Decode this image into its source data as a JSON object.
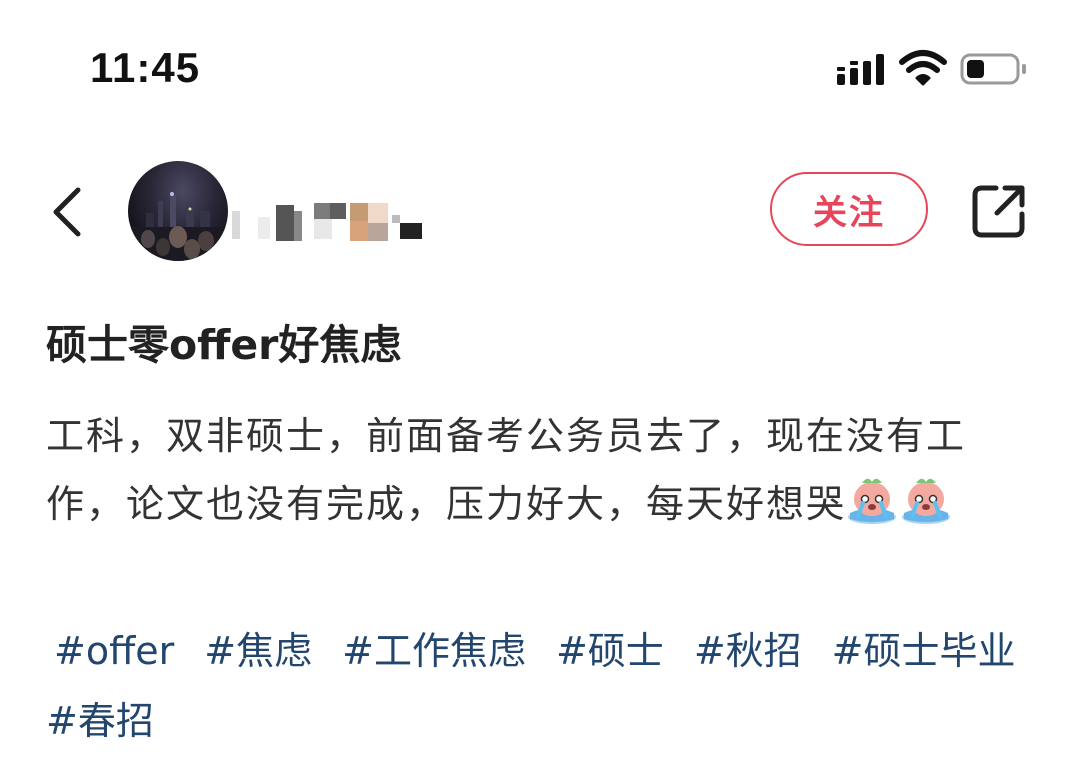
{
  "status_bar": {
    "time": "11:45",
    "signal_icon": "cellular-signal-icon",
    "wifi_icon": "wifi-icon",
    "battery_icon": "battery-icon",
    "battery_level": 0.3
  },
  "header": {
    "back_icon": "chevron-left-icon",
    "avatar_icon": "user-avatar",
    "follow_label": "关注",
    "share_icon": "share-icon",
    "accent_color": "#e6455a"
  },
  "post": {
    "title": "硕士零offer好焦虑",
    "body": "工科，双非硕士，前面备考公务员去了，现在没有工作，论文也没有完成，压力好大，每天好想哭",
    "emojis": [
      "crying-face-emoji",
      "crying-face-emoji"
    ],
    "tags": [
      "#offer",
      "#焦虑",
      "#工作焦虑",
      "#硕士",
      "#秋招",
      "#硕士毕业",
      "#春招"
    ],
    "tag_color": "#23466f"
  }
}
